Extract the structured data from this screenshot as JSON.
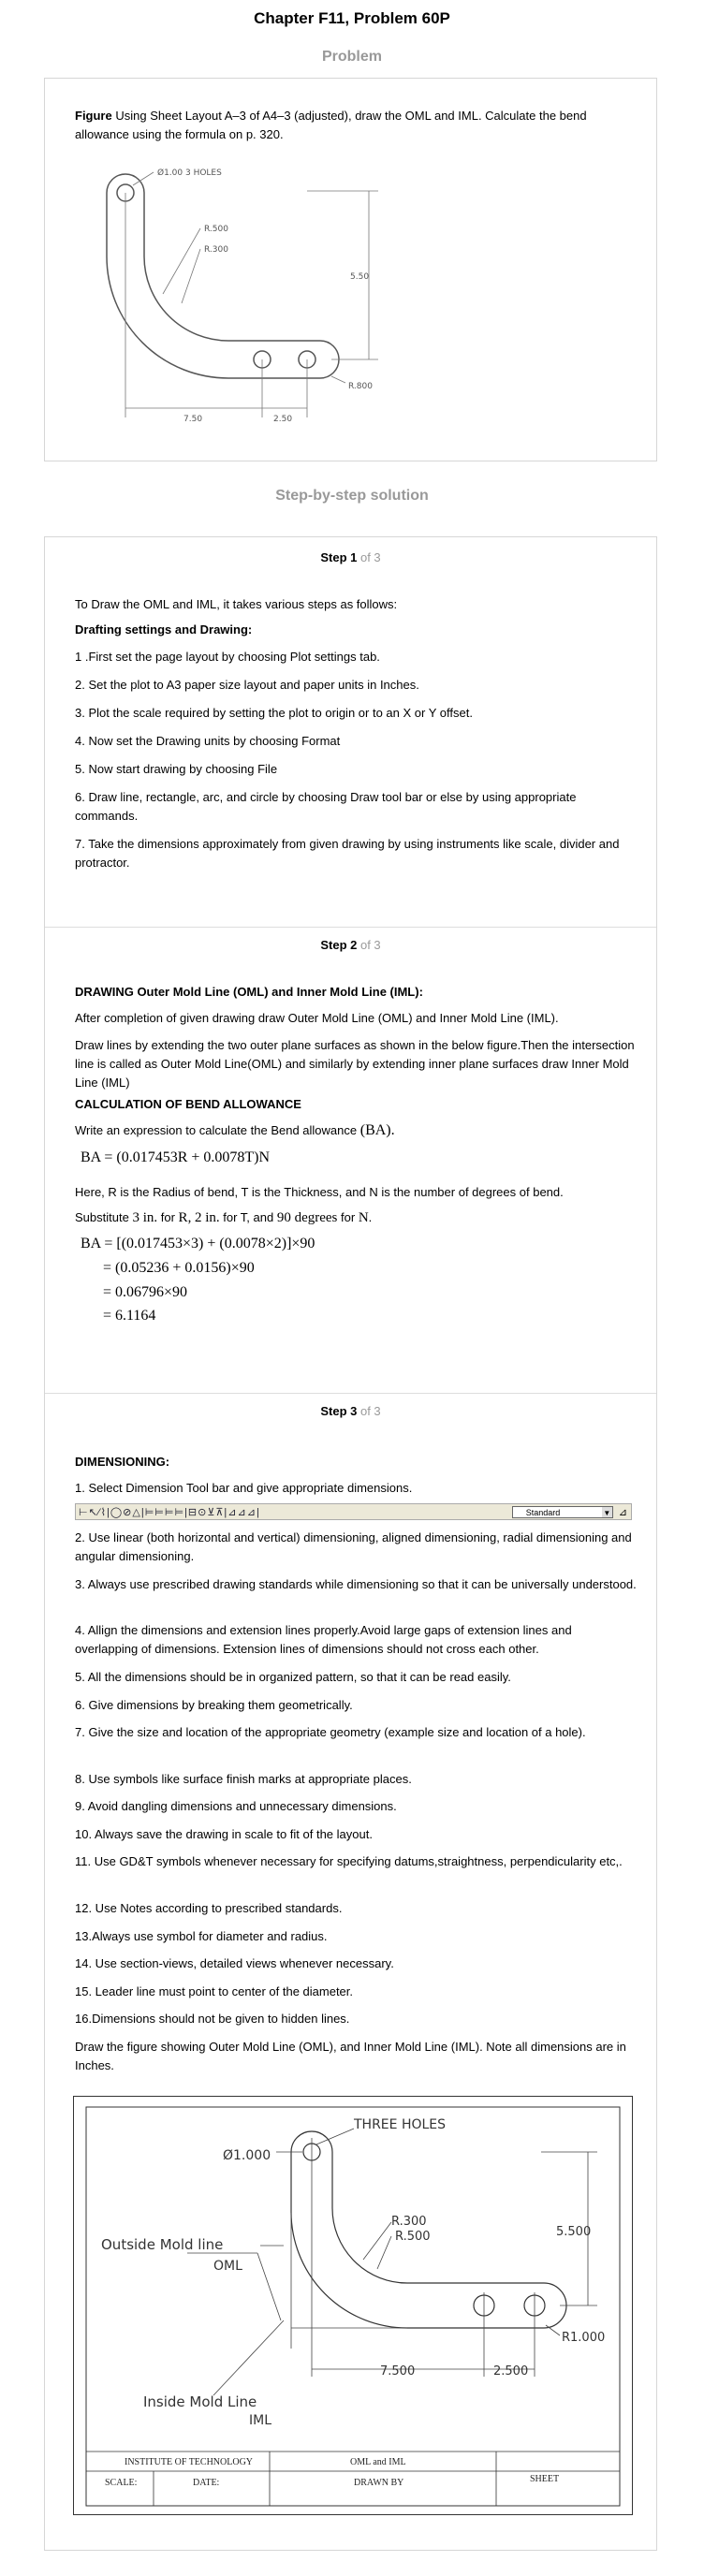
{
  "chapter_title": "Chapter F11, Problem 60P",
  "problem_heading": "Problem",
  "problem": {
    "figure_label": "Figure",
    "text": "Using Sheet Layout A–3 of A4–3 (adjusted), draw the OML and IML. Calculate the bend allowance using the formula on p. 320.",
    "fig": {
      "holes": "Ø1.00 3 HOLES",
      "r500": "R.500",
      "r300": "R.300",
      "h550": "5.50",
      "w750": "7.50",
      "w250": "2.50",
      "r800": "R.800"
    }
  },
  "solution_heading": "Step-by-step solution",
  "steps": {
    "s1": {
      "label": "Step 1",
      "of": " of 3",
      "intro": "To Draw the OML and IML, it takes various steps as follows:",
      "subhead": "Drafting settings and Drawing:",
      "items": [
        "1 .First set the page layout by choosing Plot settings tab.",
        "2. Set the plot to A3 paper size layout and paper units in Inches.",
        "3. Plot the scale required by setting the plot to origin or to an X or Y offset.",
        "4. Now set the Drawing units by choosing Format",
        "5. Now start drawing by choosing File",
        "6. Draw line, rectangle, arc, and circle by choosing Draw tool bar or else by using appropriate commands.",
        "7. Take the dimensions approximately from given drawing by using instruments like scale, divider and protractor."
      ]
    },
    "s2": {
      "label": "Step 2",
      "of": " of 3",
      "subhead": "DRAWING Outer Mold Line (OML) and Inner Mold Line (IML):",
      "p1": "After completion of given drawing draw Outer Mold Line (OML) and Inner Mold Line (IML).",
      "p2": "Draw lines by extending the two outer plane surfaces as shown in the below figure.Then the intersection line is called as Outer Mold Line(OML) and similarly by extending inner plane surfaces draw Inner Mold Line (IML)",
      "subhead2": "CALCULATION OF BEND ALLOWANCE",
      "p3": "Write an expression to calculate the Bend allowance",
      "p3_math": "(BA).",
      "formula": "BA = (0.017453R + 0.0078T)N",
      "p4": "Here, R is the Radius of bend, T is the Thickness, and N is the number of degrees of bend.",
      "sub_line": {
        "a": "Substitute",
        "b": "3 in.",
        "c": "for",
        "d": "R",
        "e": ",",
        "f": "2 in.",
        "g": "for T, and",
        "h": "90 degrees",
        "i": "for",
        "j": "N",
        "k": "."
      },
      "calc": [
        "BA = [(0.017453×3) + (0.0078×2)]×90",
        "= (0.05236 + 0.0156)×90",
        "= 0.06796×90",
        "= 6.1164"
      ]
    },
    "s3": {
      "label": "Step 3",
      "of": " of 3",
      "subhead": "DIMENSIONING:",
      "item1": "1. Select Dimension Tool bar and give appropriate dimensions.",
      "toolbar_select": "Standard",
      "items": [
        "2. Use linear (both horizontal and vertical) dimensioning, aligned dimensioning, radial dimensioning and angular dimensioning.",
        "3. Always use prescribed drawing standards while dimensioning so that it can be universally understood.",
        "4. Allign the dimensions and extension lines properly.Avoid large gaps of extension lines and overlapping of dimensions. Extension lines of dimensions should not cross each other.",
        "5. All the dimensions should be in organized pattern, so that it can be read easily.",
        "6. Give dimensions by breaking them geometrically.",
        "7. Give the size and location of the appropriate geometry (example size and location of a hole).",
        "8. Use symbols like surface finish marks at appropriate places.",
        "9. Avoid dangling dimensions and unnecessary dimensions.",
        "10. Always save the drawing in scale to fit of the layout.",
        "11. Use GD&T symbols whenever necessary for specifying datums,straightness, perpendicularity etc,.",
        "12. Use Notes according to prescribed standards.",
        "13.Always use symbol for diameter and radius.",
        "14. Use section-views, detailed views whenever necessary.",
        "15. Leader line must point to center of the diameter.",
        "16.Dimensions should not be given to hidden lines."
      ],
      "final_text": "Draw the figure showing Outer Mold Line (OML), and Inner Mold Line (IML). Note all dimensions are in Inches.",
      "fig2": {
        "holes": "THREE HOLES",
        "dia": "Ø1.000",
        "r300": "R.300",
        "r500": "R.500",
        "h550": "5.500",
        "outside": "Outside Mold line",
        "oml": "OML",
        "inside": "Inside Mold Line",
        "iml": "IML",
        "w750": "7.500",
        "w250": "2.500",
        "r1000": "R1.000",
        "tb_inst": "INSTITUTE OF TECHNOLOGY",
        "tb_title": "OML and IML",
        "tb_scale": "SCALE:",
        "tb_date": "DATE:",
        "tb_drawn": "DRAWN BY",
        "tb_sheet": "SHEET"
      }
    }
  }
}
